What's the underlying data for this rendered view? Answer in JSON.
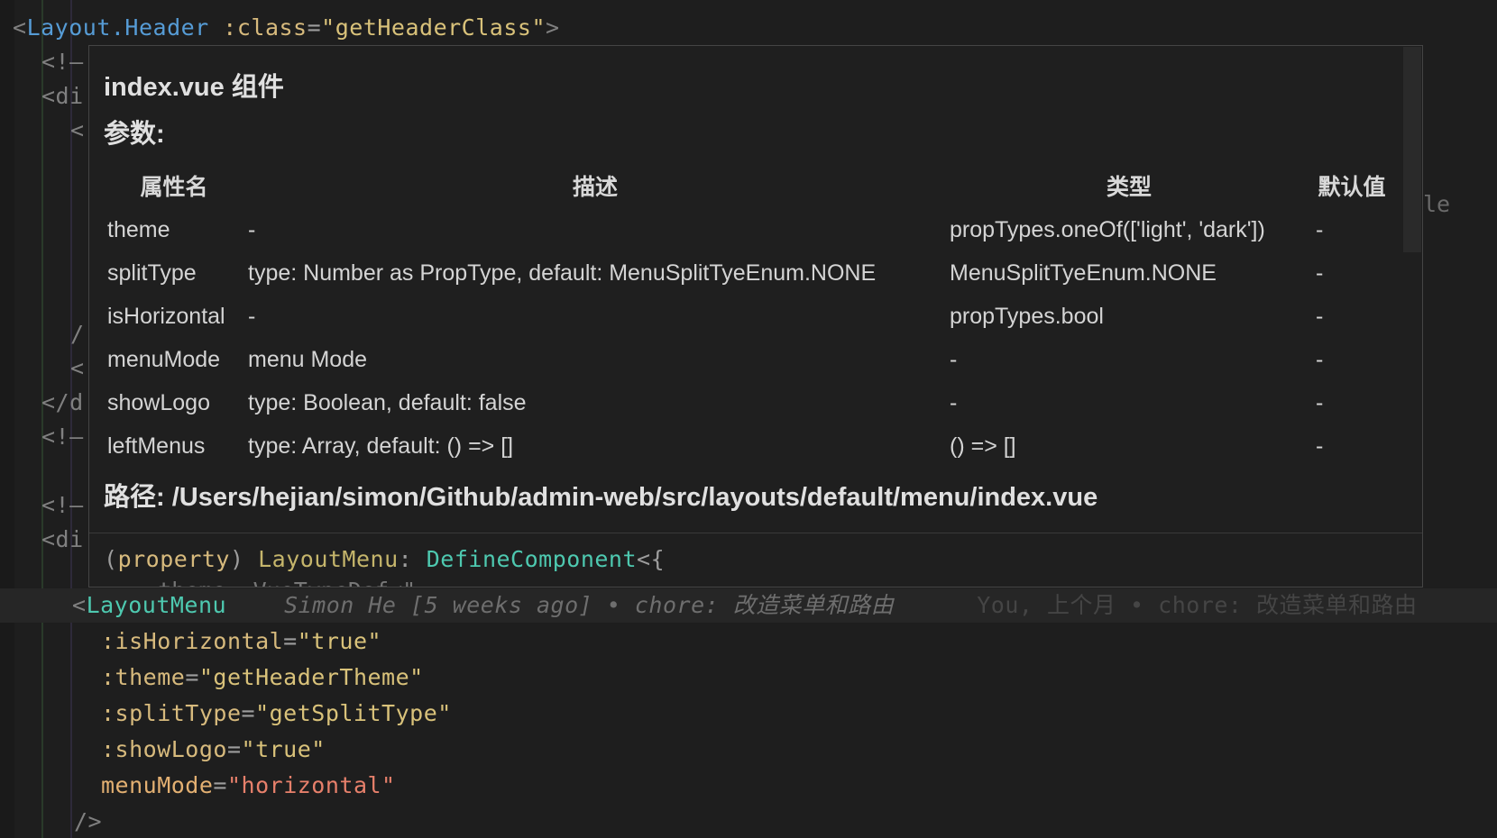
{
  "code": {
    "line1": {
      "open": "<",
      "tag": "Layout.Header",
      "attr": ":class",
      "eq": "=",
      "value": "\"getHeaderClass\"",
      "close": ">"
    },
    "comment1": "<!—",
    "div1": "<di",
    "comment_inner": "<!",
    "slash_fragment": "/",
    "lt_fragment": "<",
    "close_div": "</d",
    "comment2": "<!—",
    "comment3": "<!—",
    "div2": "<di",
    "peek_right": "le",
    "current": {
      "open": "<",
      "tag": "LayoutMenu"
    },
    "blame": "Simon He [5 weeks ago] • chore: 改造菜单和路由",
    "blame_you": "You, 上个月 • chore: 改造菜单和路由",
    "attrs": [
      {
        "name": ":isHorizontal",
        "value": "\"true\""
      },
      {
        "name": ":theme",
        "value": "\"getHeaderTheme\""
      },
      {
        "name": ":splitType",
        "value": "\"getSplitType\""
      },
      {
        "name": ":showLogo",
        "value": "\"true\""
      },
      {
        "name": "menuMode",
        "value": "\"horizontal\""
      }
    ],
    "self_close": "/>"
  },
  "hover": {
    "title": "index.vue 组件",
    "params_label": "参数:",
    "columns": [
      "属性名",
      "描述",
      "类型",
      "默认值"
    ],
    "rows": [
      {
        "name": "theme",
        "desc": "-",
        "type": "propTypes.oneOf(['light', 'dark'])",
        "default": "-"
      },
      {
        "name": "splitType",
        "desc": "type: Number as PropType, default: MenuSplitTyeEnum.NONE",
        "type": "MenuSplitTyeEnum.NONE",
        "default": "-"
      },
      {
        "name": "isHorizontal",
        "desc": "-",
        "type": "propTypes.bool",
        "default": "-"
      },
      {
        "name": "menuMode",
        "desc": "menu Mode",
        "type": "-",
        "default": "-"
      },
      {
        "name": "showLogo",
        "desc": "type: Boolean, default: false",
        "type": "-",
        "default": "-"
      },
      {
        "name": "leftMenus",
        "desc": "type: Array, default: () => []",
        "type": "() => []",
        "default": "-"
      }
    ],
    "path": "路径: /Users/hejian/simon/Github/admin-web/src/layouts/default/menu/index.vue",
    "signature": {
      "open": "(",
      "kw": "property",
      "close": ")",
      "name": "LayoutMenu",
      "colon": ":",
      "type": "DefineComponent",
      "tail": "<{"
    },
    "next_line": "    theme: VueTypeDef<\""
  }
}
